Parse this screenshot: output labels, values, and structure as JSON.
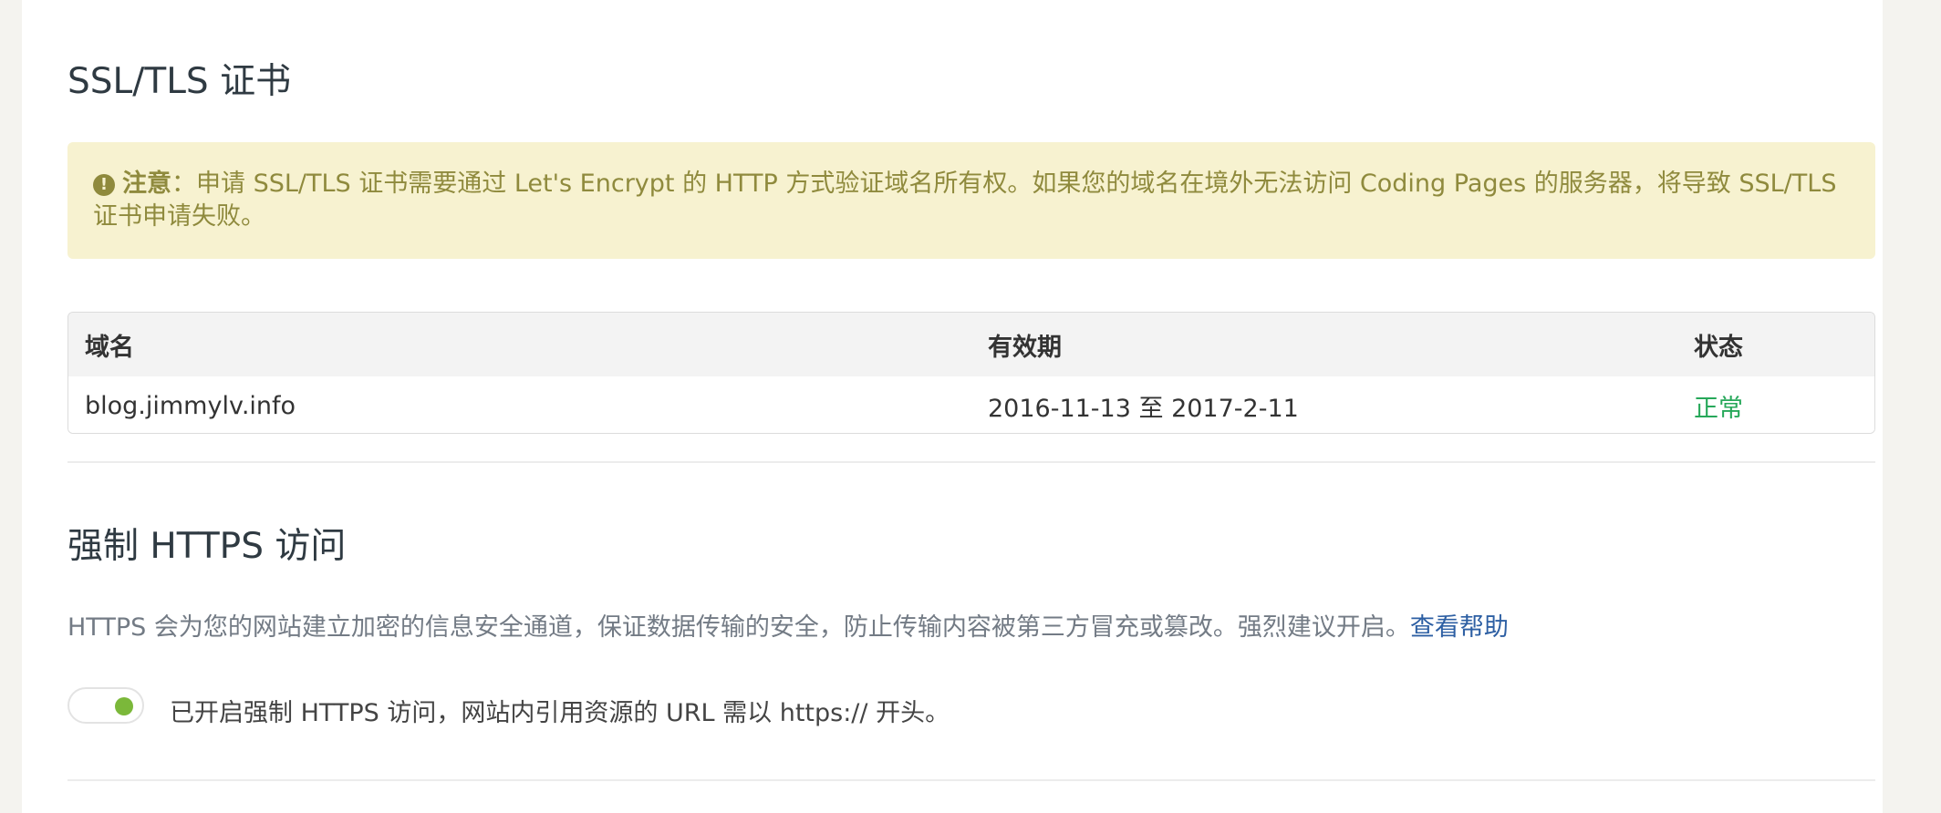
{
  "ssl_section": {
    "title": "SSL/TLS 证书",
    "notice": {
      "icon": "warning-icon",
      "label": "注意",
      "separator": "：",
      "text": "申请 SSL/TLS 证书需要通过 Let's Encrypt 的 HTTP 方式验证域名所有权。如果您的域名在境外无法访问 Coding Pages 的服务器，将导致 SSL/TLS 证书申请失败。"
    },
    "table": {
      "headers": [
        "域名",
        "有效期",
        "状态"
      ],
      "rows": [
        {
          "domain": "blog.jimmylv.info",
          "validity": "2016-11-13 至 2017-2-11",
          "status": "正常"
        }
      ]
    }
  },
  "https_section": {
    "title": "强制 HTTPS 访问",
    "description": "HTTPS 会为您的网站建立加密的信息安全通道，保证数据传输的安全，防止传输内容被第三方冒充或篡改。强烈建议开启。",
    "help_link": "查看帮助",
    "toggle": {
      "enabled": true,
      "label": "已开启强制 HTTPS 访问，网站内引用资源的 URL 需以 https:// 开头。"
    }
  },
  "colors": {
    "notice_bg": "#f7f2d0",
    "notice_text": "#8f8a3d",
    "status_ok": "#27a85a",
    "link": "#2d5fa3",
    "toggle_on": "#7bb83a"
  }
}
